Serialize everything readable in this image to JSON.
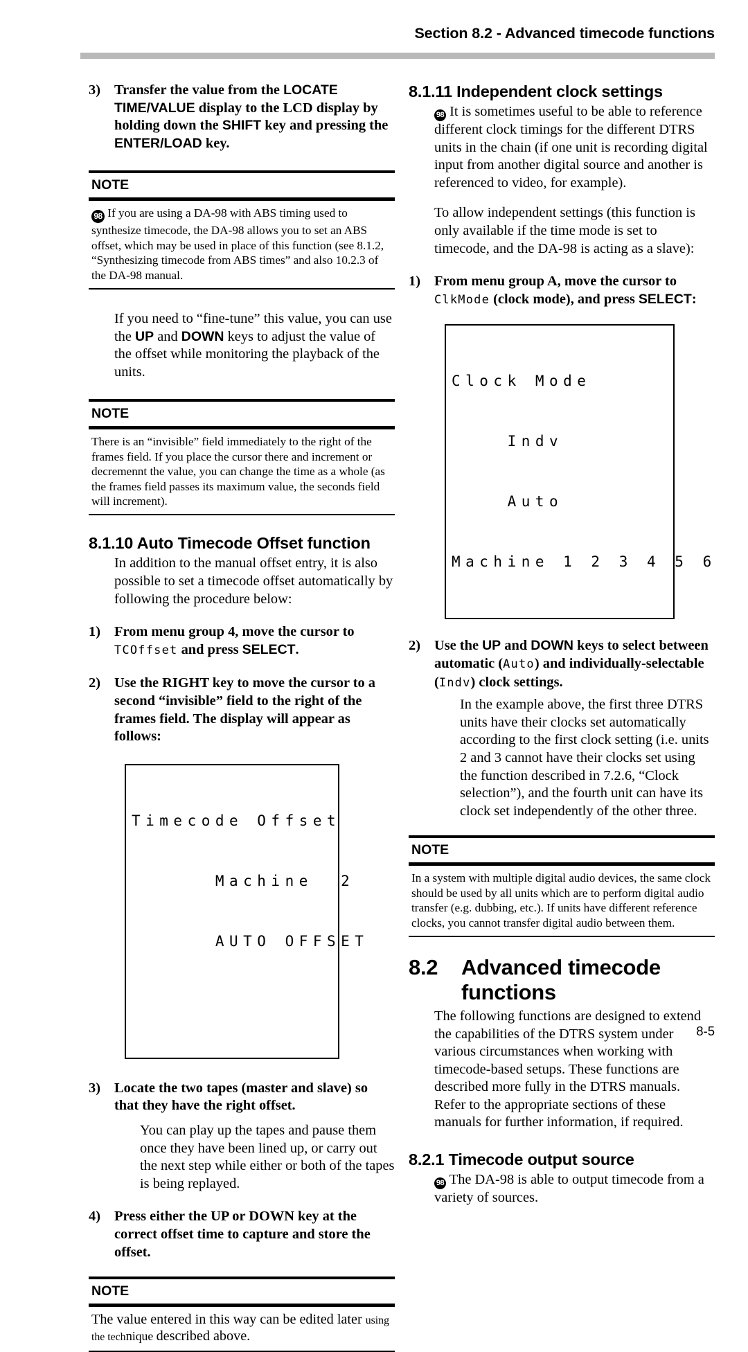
{
  "header": {
    "title": "Section 8.2 - Advanced timecode functions"
  },
  "footer": {
    "page_number": "8-5"
  },
  "icons": {
    "da98_badge": "98"
  },
  "left_column": {
    "step3": {
      "num": "3)",
      "part1": "Transfer the value from the ",
      "bold1": "LOCATE TIME/",
      "bold2": "VALUE",
      "part2": " display to the LCD display by holding down the ",
      "bold3": "SHIFT",
      "part3": " key and pressing the ",
      "bold4": "ENTER/",
      "bold5": "LOAD",
      "part4": " key."
    },
    "note1": {
      "label": "NOTE",
      "text": "If you are using a DA-98 with ABS timing used to synthesize timecode, the DA-98 allows you to set an ABS offset, which may be used in place of this function (see 8.1.2, “Synthesizing timecode from ABS times” and also 10.2.3 of the DA-98 manual."
    },
    "para_finetune": {
      "part1": "If you need to “fine-tune” this value, you can use the ",
      "bold1": "UP",
      "part2": " and ",
      "bold2": "DOWN",
      "part3": " keys to adjust the value of the offset while monitoring the playback of the units."
    },
    "note2": {
      "label": "NOTE",
      "text": "There is an “invisible” field immediately to the right of the frames field. If you place the cursor there and increment or decremennt the value, you can change the time as a whole (as the frames field passes its maximum value, the seconds field will increment)."
    },
    "heading_8110": "8.1.10 Auto Timecode Offset function",
    "para_8110": "In addition to the manual offset entry, it is also possible to set a timecode offset automatically by following the procedure below:",
    "step1": {
      "num": "1)",
      "part1": "From menu group 4, move the cursor to ",
      "lcd1": "TC",
      "lcd2": "Offset",
      "part2": " and press ",
      "bold1": "SELECT",
      "part3": "."
    },
    "step2": {
      "num": "2)",
      "text": "Use the RIGHT key to move the cursor to a second “invisible” field to the right of the frames field. The display will appear as follows:"
    },
    "lcd_offset": {
      "line1": "Timecode Offset",
      "line2": "      Machine  2",
      "line3": "      AUTO OFFSET",
      "line4": ""
    },
    "step3b": {
      "num": "3)",
      "text": "Locate the two tapes (master and slave) so that they have the right offset."
    },
    "para_step3b": "You can play up the tapes and pause them once they have been lined up, or carry out the next step while either or both of the tapes is being replayed.",
    "step4": {
      "num": "4)",
      "text": "Press either the UP or DOWN key at the correct offset time to capture and store the offset."
    },
    "note3": {
      "label": "NOTE",
      "text_big": "The value entered in this way can be edited later ",
      "text_small1": "using the tech",
      "text_mid": "n",
      "text_small2": "ique ",
      "text_big2": "described above."
    }
  },
  "right_column": {
    "heading_8111": "8.1.11 Independent clock settings",
    "para1": "It is sometimes useful to be able to reference different clock timings for the different DTRS units in the chain (if one unit is recording digital input from another digital source and another is referenced to video, for example).",
    "para2": "To allow independent settings (this function is only available if the time mode is set to timecode, and the DA-98 is acting as a slave):",
    "step1": {
      "num": "1)",
      "part1": "From menu group A, move the cursor to ",
      "lcd1": "ClkMode",
      "part2": " (clock mode), and press ",
      "bold1": "SELECT",
      "part3": ":"
    },
    "lcd_clock": {
      "line1": "Clock Mode",
      "line2": "    Indv",
      "line3": "    Auto",
      "line4": "Machine 1 2 3 4 5 6"
    },
    "step2": {
      "num": "2)",
      "part1": "Use the ",
      "bold1": "UP",
      "part2": " and ",
      "bold2": "DOWN",
      "part3": " keys to select between automatic (",
      "lcd1": "Auto",
      "part4": ") and individually-selectable (",
      "lcd2": "Indv",
      "part5": ") clock settings."
    },
    "para_step2": "In the example above, the first three DTRS units have their clocks set automatically according to the first clock setting (i.e. units 2 and 3 cannot have their clocks set using the function described in 7.2.6, “Clock selection”), and the fourth unit can have its clock set independently of the other three.",
    "note1": {
      "label": "NOTE",
      "text": "In a system with multiple digital audio devices, the same clock should be used by all units which are to perform digital audio transfer (e.g. dubbing, etc.). If units have different reference clocks, you cannot transfer digital audio between them."
    },
    "heading_82": {
      "num": "8.2",
      "text": "Advanced timecode functions"
    },
    "para_82": "The following functions are designed to extend the capabilities of the DTRS system under various circumstances when working with timecode-based setups. These functions are described more fully in the DTRS manuals. Refer to the appropriate sections of these manuals for further information, if required.",
    "heading_821": "8.2.1   Timecode output source",
    "para_821": "The DA-98 is able to output timecode from a variety of sources."
  }
}
